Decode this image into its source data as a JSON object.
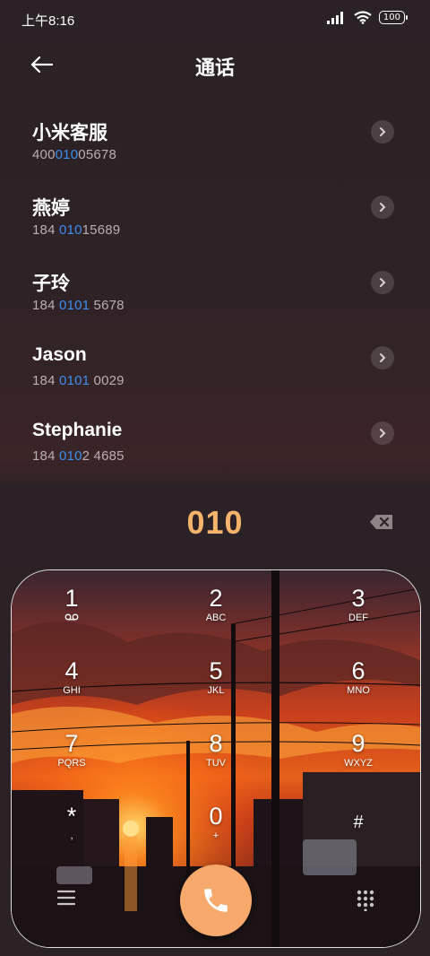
{
  "status": {
    "time": "上午8:16",
    "battery": "100"
  },
  "header": {
    "title": "通话"
  },
  "contacts": [
    {
      "name": "小米客服",
      "number_pre": "400",
      "number_hl": "010",
      "number_post": "05678"
    },
    {
      "name": "燕婷",
      "number_pre": "184 ",
      "number_hl": "010",
      "number_post": "15689"
    },
    {
      "name": "子玲",
      "number_pre": "184 ",
      "number_hl": "0101",
      "number_post": " 5678"
    },
    {
      "name": "Jason",
      "number_pre": "184 ",
      "number_hl": "0101",
      "number_post": " 0029"
    },
    {
      "name": "Stephanie",
      "number_pre": "184 ",
      "number_hl": "010",
      "number_post": "2 4685"
    }
  ],
  "input": {
    "digits": "010"
  },
  "keys": [
    {
      "digit": "1",
      "letters": "voicemail"
    },
    {
      "digit": "2",
      "letters": "ABC"
    },
    {
      "digit": "3",
      "letters": "DEF"
    },
    {
      "digit": "4",
      "letters": "GHI"
    },
    {
      "digit": "5",
      "letters": "JKL"
    },
    {
      "digit": "6",
      "letters": "MNO"
    },
    {
      "digit": "7",
      "letters": "PQRS"
    },
    {
      "digit": "8",
      "letters": "TUV"
    },
    {
      "digit": "9",
      "letters": "WXYZ"
    },
    {
      "digit": "*",
      "letters": ","
    },
    {
      "digit": "0",
      "letters": "+"
    },
    {
      "digit": "#",
      "letters": ""
    }
  ],
  "colors": {
    "accent": "#f5b36b",
    "highlight": "#3b8ef0",
    "call": "#f6a96a"
  },
  "icons": {
    "back": "arrow-left-icon",
    "detail": "chevron-right-icon",
    "backspace": "backspace-icon",
    "menu": "menu-icon",
    "call": "phone-icon",
    "dialpad": "dialpad-icon"
  }
}
